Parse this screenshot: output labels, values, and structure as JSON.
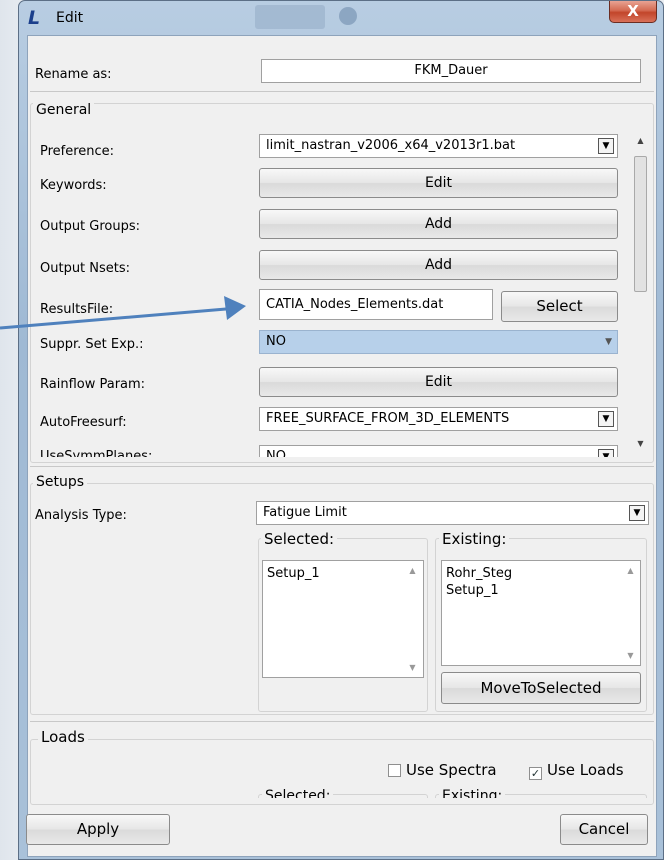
{
  "window": {
    "title": "Edit",
    "close_glyph": "X"
  },
  "rename": {
    "label": "Rename as:",
    "value": "FKM_Dauer"
  },
  "general": {
    "title": "General",
    "rows": {
      "preference": {
        "label": "Preference:",
        "value": "limit_nastran_v2006_x64_v2013r1.bat"
      },
      "keywords": {
        "label": "Keywords:",
        "button": "Edit"
      },
      "output_groups": {
        "label": "Output Groups:",
        "button": "Add"
      },
      "output_nsets": {
        "label": "Output Nsets:",
        "button": "Add"
      },
      "results_file": {
        "label": "ResultsFile:",
        "value": "CATIA_Nodes_Elements.dat",
        "button": "Select"
      },
      "suppr_set": {
        "label": "Suppr. Set Exp.:",
        "value": "NO"
      },
      "rainflow": {
        "label": "Rainflow Param:",
        "button": "Edit"
      },
      "autofreesurf": {
        "label": "AutoFreesurf:",
        "value": "FREE_SURFACE_FROM_3D_ELEMENTS"
      },
      "usesymm": {
        "label": "UseSymmPlanes:",
        "value": "NO"
      }
    }
  },
  "setups": {
    "title": "Setups",
    "analysis_type": {
      "label": "Analysis Type:",
      "value": "Fatigue Limit"
    },
    "selected": {
      "title": "Selected:",
      "items": [
        "Setup_1"
      ]
    },
    "existing": {
      "title": "Existing:",
      "items": [
        "Rohr_Steg",
        "Setup_1"
      ]
    },
    "move_button": "MoveToSelected"
  },
  "loads": {
    "title": "Loads",
    "use_spectra": "Use Spectra",
    "use_loads": "Use Loads",
    "use_loads_checked": true,
    "partial_selected": "Selected:",
    "partial_existing": "Existing:"
  },
  "footer": {
    "apply": "Apply",
    "cancel": "Cancel"
  },
  "colors": {
    "highlight": "#b7d0ea",
    "arrow": "#4f81bd"
  }
}
